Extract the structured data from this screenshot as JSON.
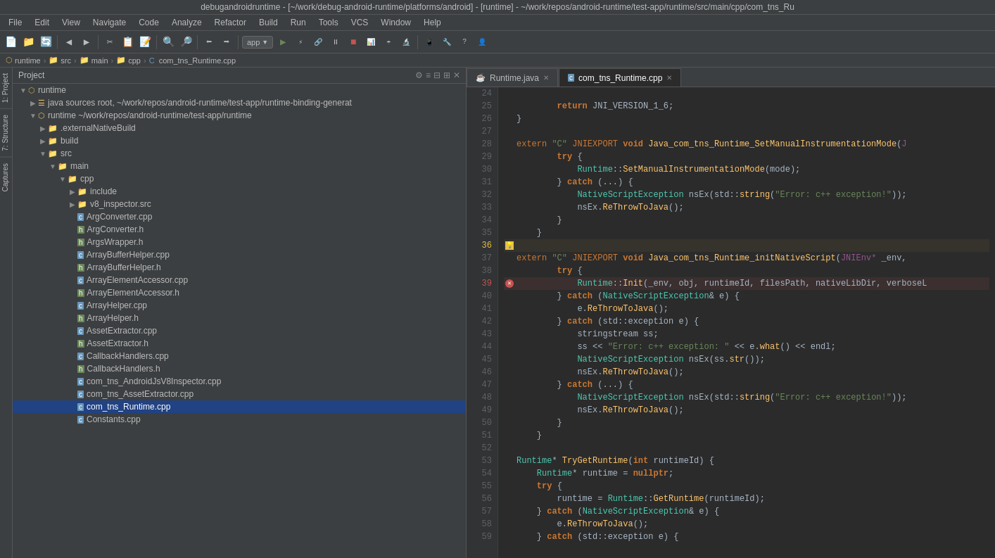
{
  "titleBar": {
    "text": "debugandroidruntime - [~/work/debug-android-runtime/platforms/android] - [runtime] - ~/work/repos/android-runtime/test-app/runtime/src/main/cpp/com_tns_Ru"
  },
  "menuBar": {
    "items": [
      "File",
      "Edit",
      "View",
      "Navigate",
      "Code",
      "Analyze",
      "Refactor",
      "Build",
      "Run",
      "Tools",
      "VCS",
      "Window",
      "Help"
    ]
  },
  "breadcrumb": {
    "items": [
      "runtime",
      "src",
      "main",
      "cpp",
      "com_tns_Runtime.cpp"
    ]
  },
  "projectPanel": {
    "title": "Project"
  },
  "tree": {
    "items": [
      {
        "id": "runtime-root",
        "label": "runtime",
        "indent": 1,
        "type": "module",
        "expanded": true
      },
      {
        "id": "java",
        "label": "java  sources root, ~/work/repos/android-runtime/test-app/runtime-binding-generat",
        "indent": 2,
        "type": "src-root",
        "expanded": false
      },
      {
        "id": "runtime-sub",
        "label": "runtime  ~/work/repos/android-runtime/test-app/runtime",
        "indent": 2,
        "type": "module",
        "expanded": true
      },
      {
        "id": "externalNativeBuild",
        "label": ".externalNativeBuild",
        "indent": 3,
        "type": "folder",
        "expanded": false
      },
      {
        "id": "build",
        "label": "build",
        "indent": 3,
        "type": "folder",
        "expanded": false
      },
      {
        "id": "src",
        "label": "src",
        "indent": 3,
        "type": "folder",
        "expanded": true
      },
      {
        "id": "main",
        "label": "main",
        "indent": 4,
        "type": "folder",
        "expanded": true
      },
      {
        "id": "cpp",
        "label": "cpp",
        "indent": 5,
        "type": "folder",
        "expanded": true
      },
      {
        "id": "include",
        "label": "include",
        "indent": 6,
        "type": "folder",
        "expanded": false
      },
      {
        "id": "v8_inspector_src",
        "label": "v8_inspector.src",
        "indent": 6,
        "type": "folder",
        "expanded": false
      },
      {
        "id": "ArgConverter_cpp",
        "label": "ArgConverter.cpp",
        "indent": 6,
        "type": "cpp"
      },
      {
        "id": "ArgConverter_h",
        "label": "ArgConverter.h",
        "indent": 6,
        "type": "h"
      },
      {
        "id": "ArgsWrapper_h",
        "label": "ArgsWrapper.h",
        "indent": 6,
        "type": "h"
      },
      {
        "id": "ArrayBufferHelper_cpp",
        "label": "ArrayBufferHelper.cpp",
        "indent": 6,
        "type": "cpp"
      },
      {
        "id": "ArrayBufferHelper_h",
        "label": "ArrayBufferHelper.h",
        "indent": 6,
        "type": "h"
      },
      {
        "id": "ArrayElementAccessor_cpp",
        "label": "ArrayElementAccessor.cpp",
        "indent": 6,
        "type": "cpp"
      },
      {
        "id": "ArrayElementAccessor_h",
        "label": "ArrayElementAccessor.h",
        "indent": 6,
        "type": "h"
      },
      {
        "id": "ArrayHelper_cpp",
        "label": "ArrayHelper.cpp",
        "indent": 6,
        "type": "cpp"
      },
      {
        "id": "ArrayHelper_h",
        "label": "ArrayHelper.h",
        "indent": 6,
        "type": "h"
      },
      {
        "id": "AssetExtractor_cpp",
        "label": "AssetExtractor.cpp",
        "indent": 6,
        "type": "cpp"
      },
      {
        "id": "AssetExtractor_h",
        "label": "AssetExtractor.h",
        "indent": 6,
        "type": "h"
      },
      {
        "id": "CallbackHandlers_cpp",
        "label": "CallbackHandlers.cpp",
        "indent": 6,
        "type": "cpp"
      },
      {
        "id": "CallbackHandlers_h",
        "label": "CallbackHandlers.h",
        "indent": 6,
        "type": "h"
      },
      {
        "id": "com_tns_AndroidJsV8Inspector_cpp",
        "label": "com_tns_AndroidJsV8Inspector.cpp",
        "indent": 6,
        "type": "cpp"
      },
      {
        "id": "com_tns_AssetExtractor_cpp",
        "label": "com_tns_AssetExtractor.cpp",
        "indent": 6,
        "type": "cpp"
      },
      {
        "id": "com_tns_Runtime_cpp",
        "label": "com_tns_Runtime.cpp",
        "indent": 6,
        "type": "cpp",
        "selected": true
      },
      {
        "id": "Constants_cpp",
        "label": "Constants.cpp",
        "indent": 6,
        "type": "cpp"
      }
    ]
  },
  "editorTabs": [
    {
      "id": "Runtime_java",
      "label": "Runtime.java",
      "type": "java",
      "active": false
    },
    {
      "id": "com_tns_Runtime_cpp",
      "label": "com_tns_Runtime.cpp",
      "type": "cpp",
      "active": true
    }
  ],
  "codeLines": [
    {
      "num": 24,
      "content": "",
      "gutter": ""
    },
    {
      "num": 25,
      "content": "        return JNI_VERSION_1_6;",
      "gutter": ""
    },
    {
      "num": 26,
      "content": "}",
      "gutter": ""
    },
    {
      "num": 27,
      "content": "",
      "gutter": ""
    },
    {
      "num": 28,
      "content": "extern \"C\" JNIEXPORT void Java_com_tns_Runtime_SetManualInstrumentationMode(J",
      "gutter": ""
    },
    {
      "num": 29,
      "content": "        try {",
      "gutter": ""
    },
    {
      "num": 30,
      "content": "            Runtime::SetManualInstrumentationMode(mode);",
      "gutter": ""
    },
    {
      "num": 31,
      "content": "        } catch (...) {",
      "gutter": ""
    },
    {
      "num": 32,
      "content": "            NativeScriptException nsEx(std::string(\"Error: c++ exception!\"));",
      "gutter": ""
    },
    {
      "num": 33,
      "content": "            nsEx.ReThrowToJava();",
      "gutter": ""
    },
    {
      "num": 34,
      "content": "        }",
      "gutter": ""
    },
    {
      "num": 35,
      "content": "    }",
      "gutter": ""
    },
    {
      "num": 36,
      "content": "",
      "gutter": "warning"
    },
    {
      "num": 37,
      "content": "extern \"C\" JNIEXPORT void Java_com_tns_Runtime_initNativeScript(JNIEnv* _env,",
      "gutter": ""
    },
    {
      "num": 38,
      "content": "        try {",
      "gutter": ""
    },
    {
      "num": 39,
      "content": "            Runtime::Init(_env, obj, runtimeId, filesPath, nativeLibDir, verboseL",
      "gutter": "error"
    },
    {
      "num": 40,
      "content": "        } catch (NativeScriptException& e) {",
      "gutter": ""
    },
    {
      "num": 41,
      "content": "            e.ReThrowToJava();",
      "gutter": ""
    },
    {
      "num": 42,
      "content": "        } catch (std::exception e) {",
      "gutter": ""
    },
    {
      "num": 43,
      "content": "            stringstream ss;",
      "gutter": ""
    },
    {
      "num": 44,
      "content": "            ss << \"Error: c++ exception: \" << e.what() << endl;",
      "gutter": ""
    },
    {
      "num": 45,
      "content": "            NativeScriptException nsEx(ss.str());",
      "gutter": ""
    },
    {
      "num": 46,
      "content": "            nsEx.ReThrowToJava();",
      "gutter": ""
    },
    {
      "num": 47,
      "content": "        } catch (...) {",
      "gutter": ""
    },
    {
      "num": 48,
      "content": "            NativeScriptException nsEx(std::string(\"Error: c++ exception!\"));",
      "gutter": ""
    },
    {
      "num": 49,
      "content": "            nsEx.ReThrowToJava();",
      "gutter": ""
    },
    {
      "num": 50,
      "content": "        }",
      "gutter": ""
    },
    {
      "num": 51,
      "content": "    }",
      "gutter": ""
    },
    {
      "num": 52,
      "content": "",
      "gutter": ""
    },
    {
      "num": 53,
      "content": "Runtime* TryGetRuntime(int runtimeId) {",
      "gutter": ""
    },
    {
      "num": 54,
      "content": "    Runtime* runtime = nullptr;",
      "gutter": ""
    },
    {
      "num": 55,
      "content": "    try {",
      "gutter": ""
    },
    {
      "num": 56,
      "content": "        runtime = Runtime::GetRuntime(runtimeId);",
      "gutter": ""
    },
    {
      "num": 57,
      "content": "    } catch (NativeScriptException& e) {",
      "gutter": ""
    },
    {
      "num": 58,
      "content": "        e.ReThrowToJava();",
      "gutter": ""
    },
    {
      "num": 59,
      "content": "    } catch (std::exception e) {",
      "gutter": ""
    }
  ]
}
